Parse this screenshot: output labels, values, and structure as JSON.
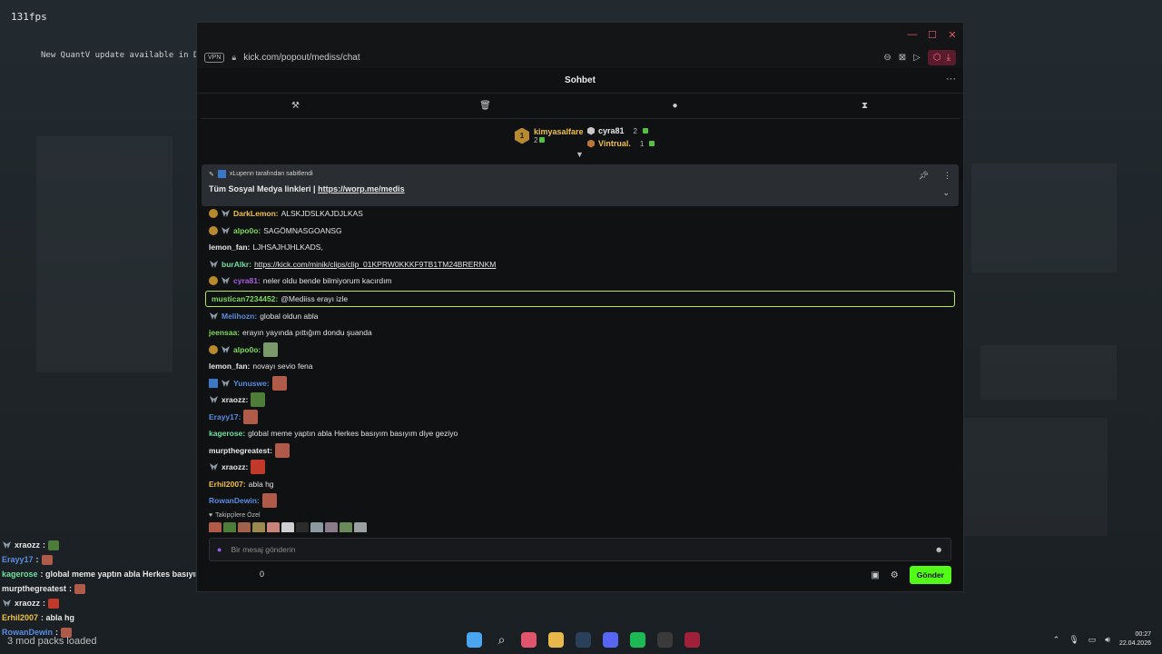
{
  "overlay": {
    "fps": "131fps",
    "toast": "New QuantV update available in Discor",
    "mod_packs": "3 mod packs loaded",
    "chat": [
      {
        "user": "xraozz",
        "text": ":",
        "color": "#e6e6e6",
        "mod": true,
        "emote": "#4e7d3a"
      },
      {
        "user": "Erayy17",
        "text": ":",
        "color": "#5a8de0",
        "mod": false,
        "emote": "#b05a4a"
      },
      {
        "user": "kagerose",
        "text": ": global meme yaptın abla Herkes basıyım basıyım diye geziyo",
        "color": "#6fe0a0",
        "mod": false,
        "emote": ""
      },
      {
        "user": "murpthegreatest",
        "text": ":",
        "color": "#e6e6e6",
        "mod": false,
        "emote": "#b05a4a"
      },
      {
        "user": "xraozz",
        "text": ":",
        "color": "#e6e6e6",
        "mod": true,
        "emote": "#c0392b"
      },
      {
        "user": "Erhil2007",
        "text": ": abla hg",
        "color": "#f0c040",
        "mod": false,
        "emote": ""
      },
      {
        "user": "RowanDewin",
        "text": ":",
        "color": "#5a8de0",
        "mod": false,
        "emote": "#b05a4a"
      }
    ]
  },
  "browser": {
    "vpn": "VPN",
    "url": "kick.com/popout/mediss/chat"
  },
  "chat": {
    "title": "Sohbet",
    "more": "···",
    "leaderboard": {
      "first": {
        "rank": "1",
        "name": "kimyasalfare",
        "count": "2",
        "color": "#f0c040"
      },
      "others": [
        {
          "name": "cyra81",
          "count": "2",
          "color": "#e6e6e6",
          "medal": "#c8c8c8"
        },
        {
          "name": "Vintrual.",
          "count": "1",
          "color": "#f0c040",
          "medal": "#b8763a"
        }
      ]
    },
    "pinned": {
      "header": "xLupenn tarafından sabitlendi",
      "text": "Tüm Sosyal Medya linkleri |",
      "link": "https://worp.me/medis"
    },
    "messages": [
      {
        "user": "DarkLemon:",
        "text": "ALSKJDSLKAJDJLKAS",
        "color": "#f0c040",
        "gold": true,
        "mod": true,
        "emote": ""
      },
      {
        "user": "alpo0o:",
        "text": "SAGÖMNASGOANSG",
        "color": "#7ed957",
        "gold": true,
        "mod": true,
        "emote": ""
      },
      {
        "user": "lemon_fan:",
        "text": "LJHSAJHJHLKADS,",
        "color": "#e6e6e6",
        "gold": false,
        "mod": false,
        "emote": ""
      },
      {
        "user": "burAlkr:",
        "text": "https://kick.com/minik/clips/clip_01KPRW0KKKF9TB1TM24BRERNKM",
        "color": "#6fe0a0",
        "gold": false,
        "mod": true,
        "emote": "",
        "link": true
      },
      {
        "user": "cyra81:",
        "text": "neler oldu bende bilmiyorum kacırdım",
        "color": "#a75ee0",
        "gold": true,
        "mod": true,
        "emote": ""
      },
      {
        "user": "mustican7234452:",
        "text": "@Mediiss erayı izle",
        "color": "#7ed957",
        "gold": false,
        "mod": false,
        "emote": "",
        "highlight": true
      },
      {
        "user": "Melihozn:",
        "text": "global oldun abla",
        "color": "#5a8de0",
        "gold": false,
        "mod": true,
        "emote": ""
      },
      {
        "user": "jeensaa:",
        "text": "erayın yayında pıttığım dondu şuanda",
        "color": "#7ed957",
        "gold": false,
        "mod": false,
        "emote": ""
      },
      {
        "user": "alpo0o:",
        "text": "",
        "color": "#7ed957",
        "gold": true,
        "mod": true,
        "emote": "#7a9a6a"
      },
      {
        "user": "lemon_fan:",
        "text": "novayı sevio fena",
        "color": "#e6e6e6",
        "gold": false,
        "mod": false,
        "emote": ""
      },
      {
        "user": "Yunuswe:",
        "text": "",
        "color": "#5a8de0",
        "gold": false,
        "mod": true,
        "blue": true,
        "emote": "#b05a4a"
      },
      {
        "user": "xraozz:",
        "text": "",
        "color": "#e6e6e6",
        "gold": false,
        "mod": true,
        "emote": "#4e7d3a"
      },
      {
        "user": "Erayy17:",
        "text": "",
        "color": "#5a8de0",
        "gold": false,
        "mod": false,
        "emote": "#b05a4a"
      },
      {
        "user": "kagerose:",
        "text": "global meme yaptın abla Herkes basıyım basıyım diye geziyo",
        "color": "#6fe0a0",
        "gold": false,
        "mod": false,
        "emote": ""
      },
      {
        "user": "murpthegreatest:",
        "text": "",
        "color": "#e6e6e6",
        "gold": false,
        "mod": false,
        "emote": "#b05a4a"
      },
      {
        "user": "xraozz:",
        "text": "",
        "color": "#e6e6e6",
        "gold": false,
        "mod": true,
        "emote": "#c0392b"
      },
      {
        "user": "Erhil2007:",
        "text": "abla hg",
        "color": "#f0c040",
        "gold": false,
        "mod": false,
        "emote": ""
      },
      {
        "user": "RowanDewin:",
        "text": "",
        "color": "#5a8de0",
        "gold": false,
        "mod": false,
        "emote": "#b05a4a"
      }
    ],
    "followers_label": "Takipçilere Özel",
    "follower_emotes": [
      "#b05a4a",
      "#4e7d3a",
      "#a0624a",
      "#9a8a50",
      "#c9847a",
      "#cfcfcf",
      "#2b2b2b",
      "#8a9aa0",
      "#8a7a8a",
      "#6a8a5a",
      "#9aa0a0"
    ],
    "input_placeholder": "Bir mesaj gönderin",
    "points": "0",
    "send_label": "Gönder"
  },
  "taskbar": {
    "time": "00:27",
    "date": "22.04.2026",
    "apps": [
      {
        "name": "windows-start",
        "color": "#4aa6f0"
      },
      {
        "name": "search",
        "color": "transparent"
      },
      {
        "name": "opera-gx",
        "color": "#e0556b"
      },
      {
        "name": "file-explorer",
        "color": "#e8b84a"
      },
      {
        "name": "steam",
        "color": "#2a3f5a"
      },
      {
        "name": "discord",
        "color": "#5865f2"
      },
      {
        "name": "spotify",
        "color": "#1db954"
      },
      {
        "name": "obs",
        "color": "#3a3a3a"
      },
      {
        "name": "app-a",
        "color": "#a0203a"
      }
    ]
  },
  "colors": {
    "kick_green": "#53fc18",
    "highlight_border": "#b6e84a"
  }
}
